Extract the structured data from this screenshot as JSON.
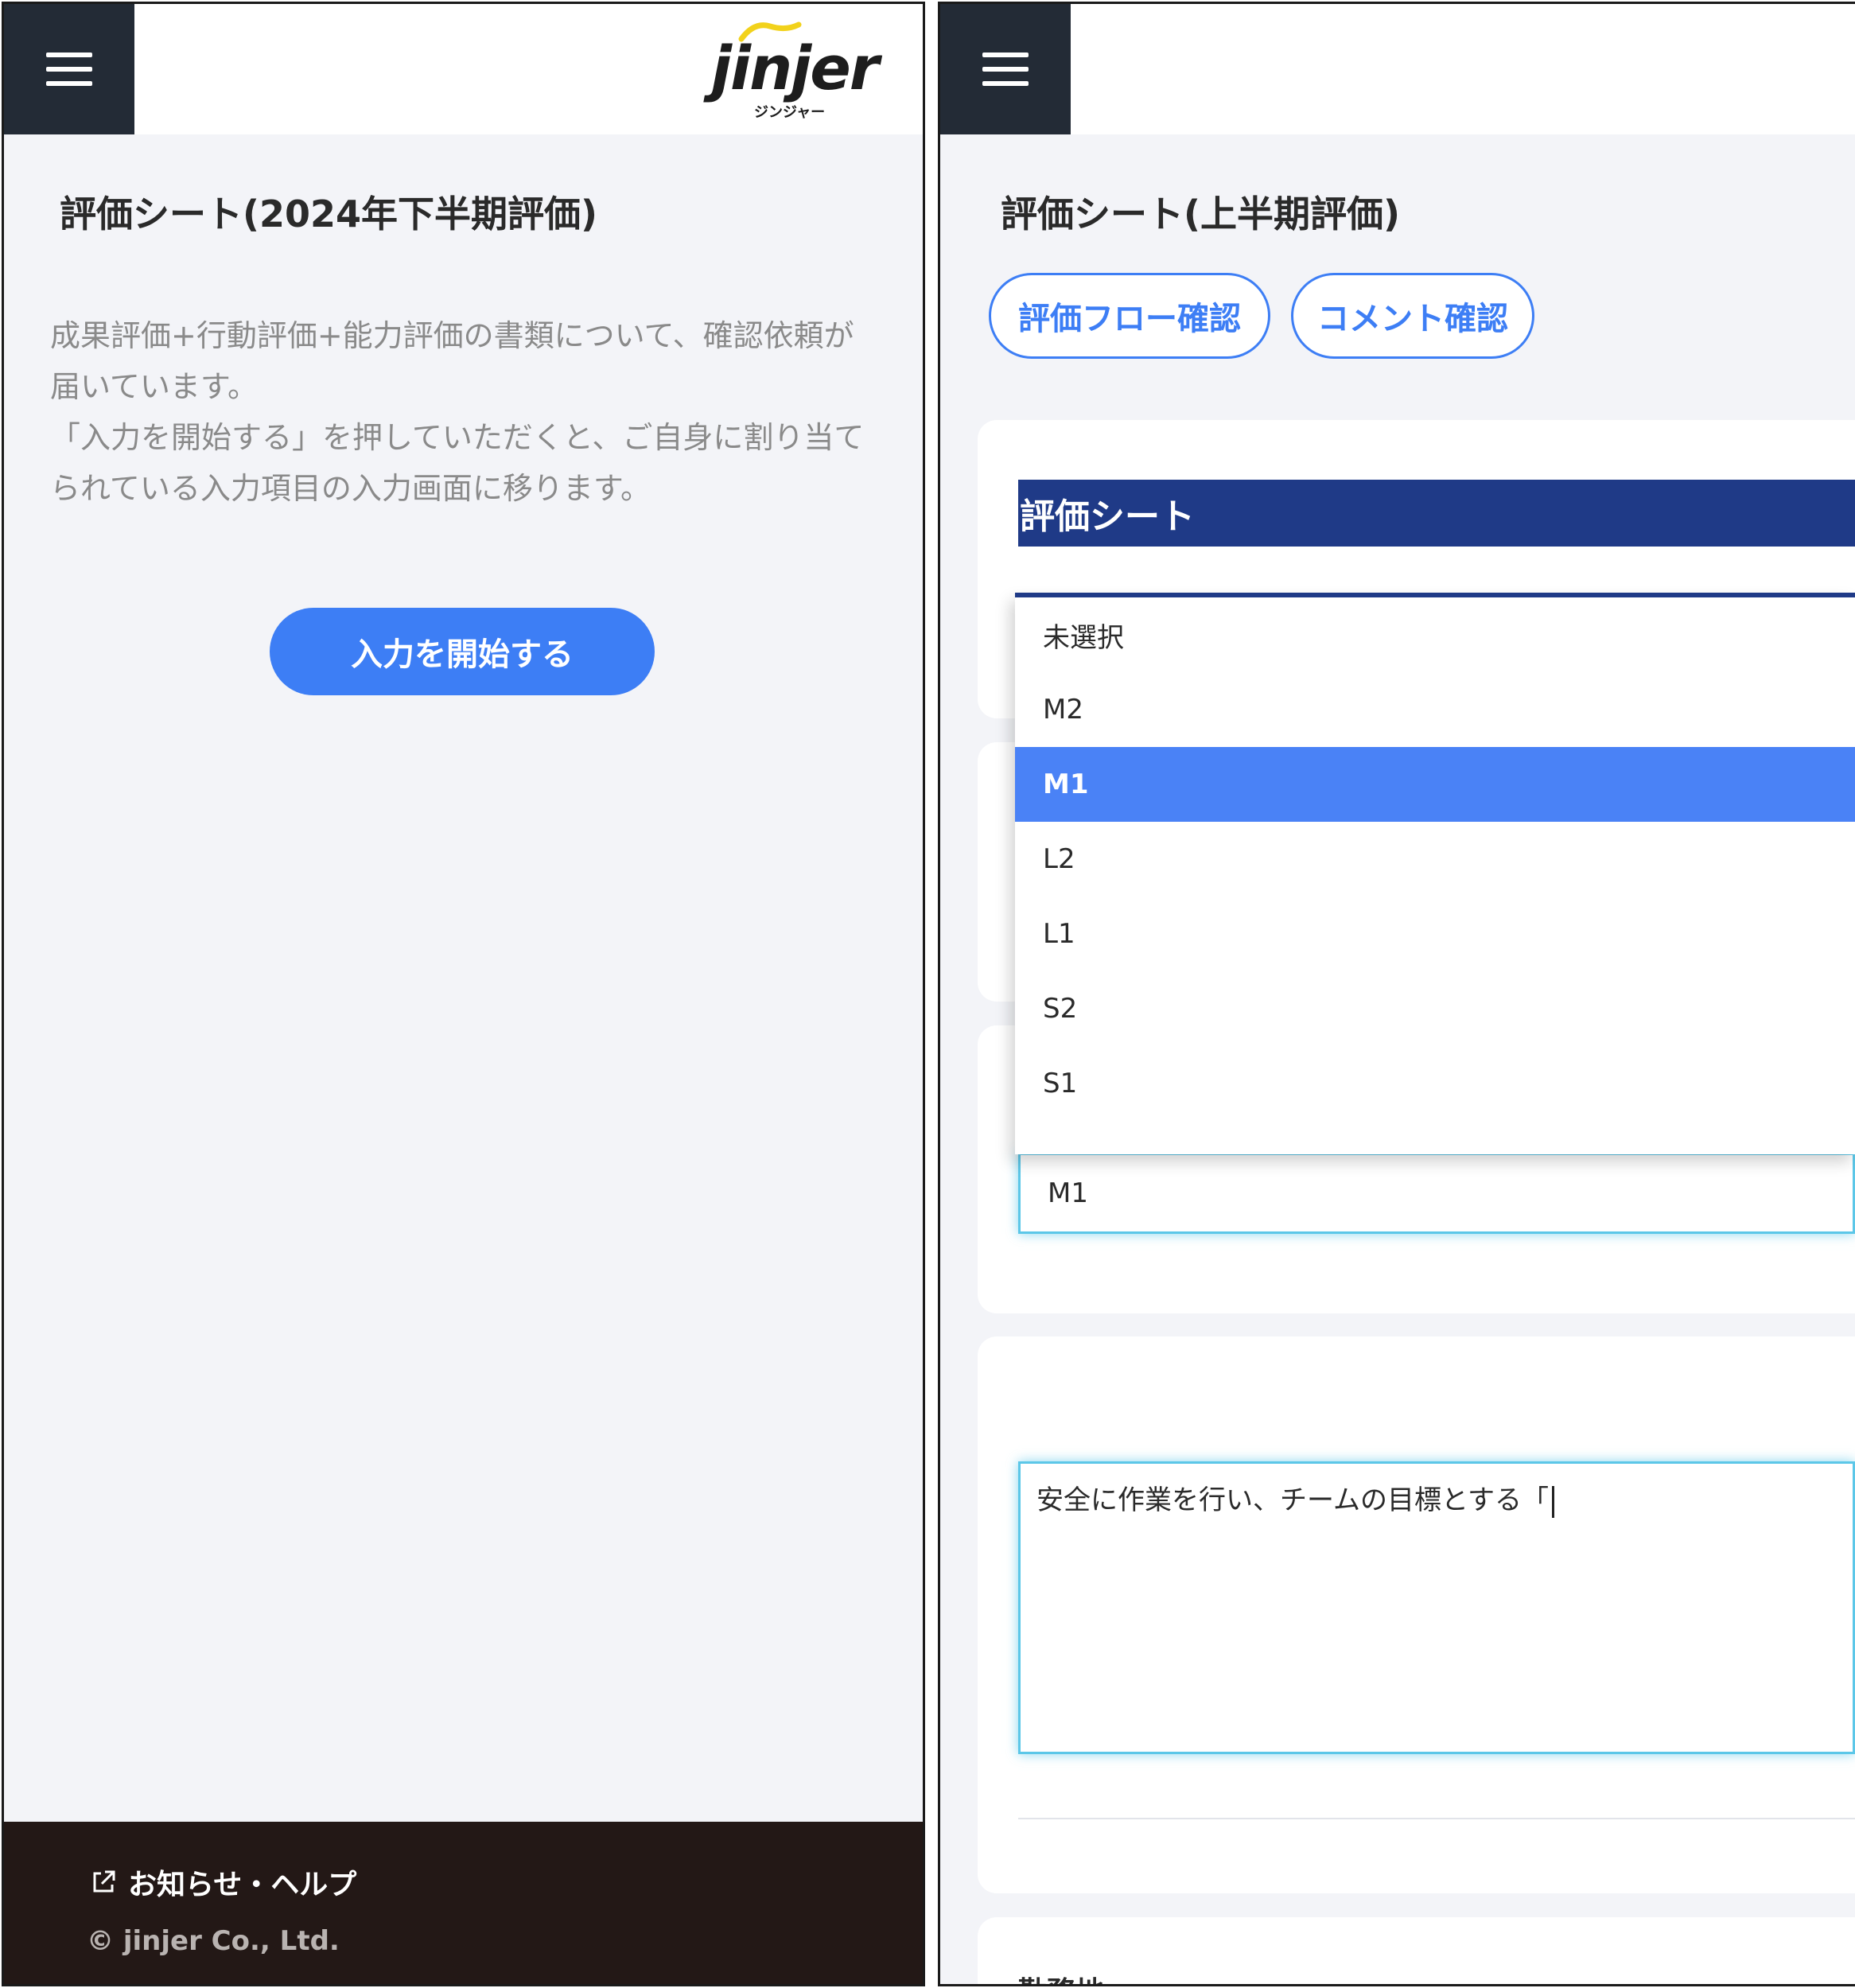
{
  "left": {
    "logo": {
      "word": "jinjer",
      "sub": "ジンジャー"
    },
    "title": "評価シート(2024年下半期評価)",
    "description": [
      "成果評価+行動評価+能力評価の書類について、確認依頼が届いています。",
      "「入力を開始する」を押していただくと、ご自身に割り当てられている入力項目の入力画面に移ります。"
    ],
    "start_button": "入力を開始する",
    "footer": {
      "help": "お知らせ・ヘルプ",
      "copyright": "© jinjer Co., Ltd."
    }
  },
  "right": {
    "title": "評価シート(上半期評価)",
    "buttons": {
      "flow": "評価フロー確認",
      "comment": "コメント確認"
    },
    "section_header": "評価シート",
    "dropdown": {
      "options": [
        "未選択",
        "M2",
        "M1",
        "L2",
        "L1",
        "S2",
        "S1"
      ],
      "selected": "M1"
    },
    "select_value": "M1",
    "textarea_value": "安全に作業を行い、チームの目標とする「",
    "bottom_label": "勤務地"
  },
  "colors": {
    "accent": "#3d7ef5",
    "header_dark": "#232b36",
    "sheet_header": "#1f3a87",
    "selected_option": "#4a82f6",
    "footer": "#231816",
    "focus": "#5cc7e8"
  }
}
